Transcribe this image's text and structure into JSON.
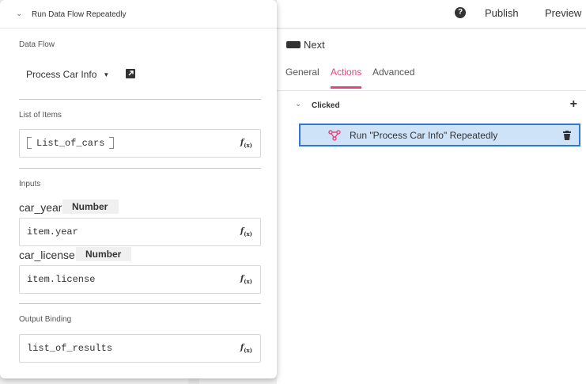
{
  "topbar": {
    "help_icon": "question-circle-icon",
    "publish_label": "Publish",
    "preview_label": "Preview"
  },
  "inspector": {
    "component_name": "Next",
    "tabs": [
      {
        "label": "General",
        "active": false
      },
      {
        "label": "Actions",
        "active": true
      },
      {
        "label": "Advanced",
        "active": false
      }
    ],
    "event": {
      "label": "Clicked"
    },
    "action": {
      "label": "Run \"Process Car Info\" Repeatedly"
    }
  },
  "popover": {
    "title": "Run Data Flow Repeatedly",
    "data_flow": {
      "label": "Data Flow",
      "value": "Process Car Info"
    },
    "list_of_items": {
      "label": "List of Items",
      "value": "List_of_cars"
    },
    "inputs": {
      "label": "Inputs",
      "items": [
        {
          "name": "car_year",
          "type": "Number",
          "value": "item.year"
        },
        {
          "name": "car_license",
          "type": "Number",
          "value": "item.license"
        }
      ]
    },
    "output_binding": {
      "label": "Output Binding",
      "value": "list_of_results"
    },
    "formula_icon": "f(x)"
  },
  "colors": {
    "accent": "#e9447a",
    "selection_border": "#2f78d2",
    "selection_fill": "#cfe3f8"
  }
}
